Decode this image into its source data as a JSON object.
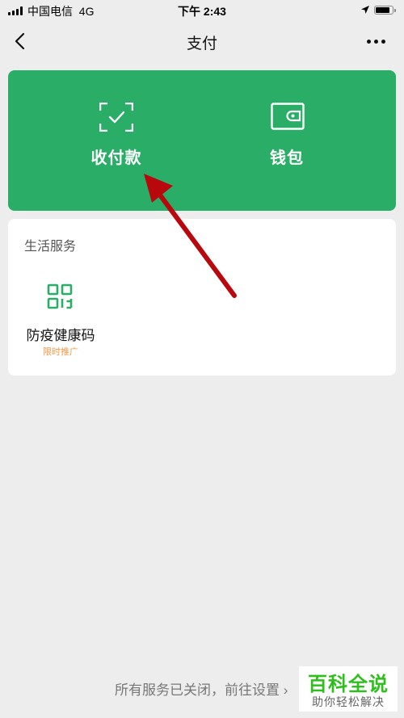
{
  "status_bar": {
    "carrier": "中国电信",
    "network": "4G",
    "time": "下午 2:43",
    "battery_level": 0.85
  },
  "nav": {
    "title": "支付",
    "back_icon": "chevron-left-icon",
    "more_icon": "more-dots-icon"
  },
  "green_card": {
    "color": "#2aae67",
    "items": [
      {
        "label": "收付款",
        "icon": "scan-check-icon"
      },
      {
        "label": "钱包",
        "icon": "wallet-icon"
      }
    ]
  },
  "services": {
    "title": "生活服务",
    "items": [
      {
        "name": "防疫健康码",
        "tag": "限时推广",
        "icon": "qr-code-icon",
        "tag_color": "#f2994a"
      }
    ]
  },
  "annotation": {
    "arrow_color": "#b8070d"
  },
  "footer": {
    "link": "所有服务已关闭，前往设置 ›"
  },
  "watermark": {
    "main": "百科全说",
    "sub": "助你轻松解决"
  }
}
